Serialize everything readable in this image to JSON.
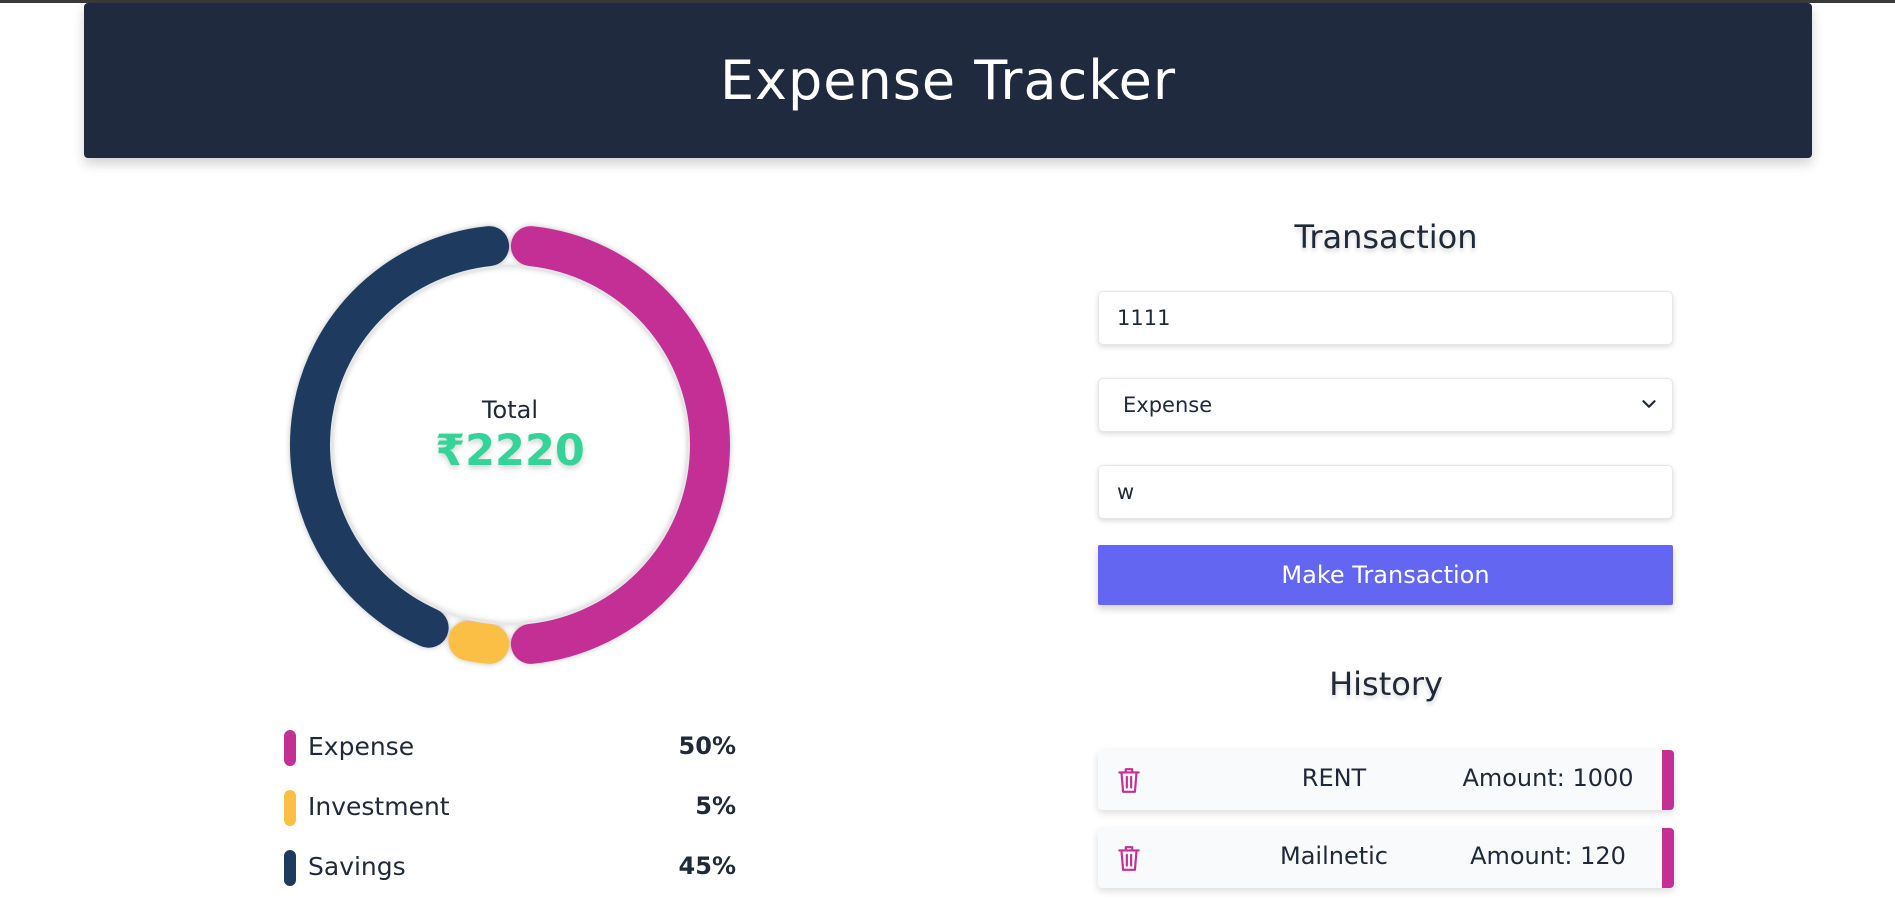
{
  "header": {
    "title": "Expense Tracker"
  },
  "summary": {
    "total_label": "Total",
    "total_value": "₹2220"
  },
  "chart_data": {
    "type": "pie",
    "categories": [
      "Expense",
      "Investment",
      "Savings"
    ],
    "values": [
      50,
      5,
      45
    ],
    "colors": [
      "#c42f96",
      "#fbbf45",
      "#1e3a5f"
    ]
  },
  "legend": [
    {
      "label": "Expense",
      "percent": "50%",
      "color": "#c42f96"
    },
    {
      "label": "Investment",
      "percent": "5%",
      "color": "#fbbf45"
    },
    {
      "label": "Savings",
      "percent": "45%",
      "color": "#1e3a5f"
    }
  ],
  "form": {
    "title": "Transaction",
    "amount_value": "1111",
    "type_selected": "Expense",
    "name_value": "w",
    "submit_label": "Make Transaction"
  },
  "history": {
    "title": "History",
    "items": [
      {
        "name": "RENT",
        "amount": "Amount: 1000",
        "color": "#c42f96"
      },
      {
        "name": "Mailnetic",
        "amount": "Amount: 120",
        "color": "#c42f96"
      }
    ]
  },
  "colors": {
    "header_bg": "#202a3e",
    "accent": "#6366f1",
    "total": "#34d399"
  }
}
